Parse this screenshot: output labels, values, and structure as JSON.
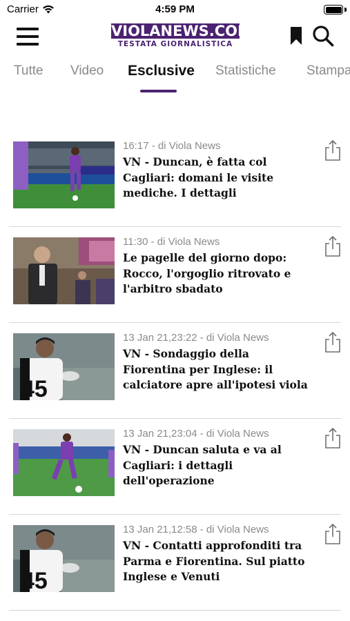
{
  "status_bar": {
    "carrier": "Carrier",
    "time": "4:59 PM"
  },
  "header": {
    "logo_main": "VIOLANEWS.COM",
    "logo_tagline": "TESTATA GIORNALISTICA",
    "brand_color": "#4b2270",
    "icons": [
      "hamburger-menu-icon",
      "bookmark-icon",
      "search-icon"
    ]
  },
  "tabs": [
    {
      "label": "Tutte",
      "active": false
    },
    {
      "label": "Video",
      "active": false
    },
    {
      "label": "Esclusive",
      "active": true
    },
    {
      "label": "Statistiche",
      "active": false
    },
    {
      "label": "Stampa",
      "active": false
    }
  ],
  "articles": [
    {
      "meta": "16:17 - di Viola News",
      "title": "VN - Duncan, è fatta col Cagliari: domani le visite mediche. I dettagli",
      "thumbnail": "player-purple-kit-on-pitch"
    },
    {
      "meta": "11:30 - di Viola News",
      "title": "Le pagelle del giorno dopo: Rocco, l'orgoglio ritrovato e l'arbitro sbadato",
      "thumbnail": "man-in-suit-press-event"
    },
    {
      "meta": "13 Jan 21,23:22 - di Viola News",
      "title": "VN - Sondaggio della Fiorentina per Inglese: il calciatore apre all'ipotesi viola",
      "thumbnail": "player-inglese-45-shirt"
    },
    {
      "meta": "13 Jan 21,23:04 - di Viola News",
      "title": "VN - Duncan saluta e va al Cagliari: i dettagli dell'operazione",
      "thumbnail": "player-purple-kit-with-ball"
    },
    {
      "meta": "13 Jan 21,12:58 - di Viola News",
      "title": "VN - Contatti approfonditi tra Parma e Fiorentina. Sul piatto Inglese e Venuti",
      "thumbnail": "player-inglese-45-shirt"
    }
  ]
}
